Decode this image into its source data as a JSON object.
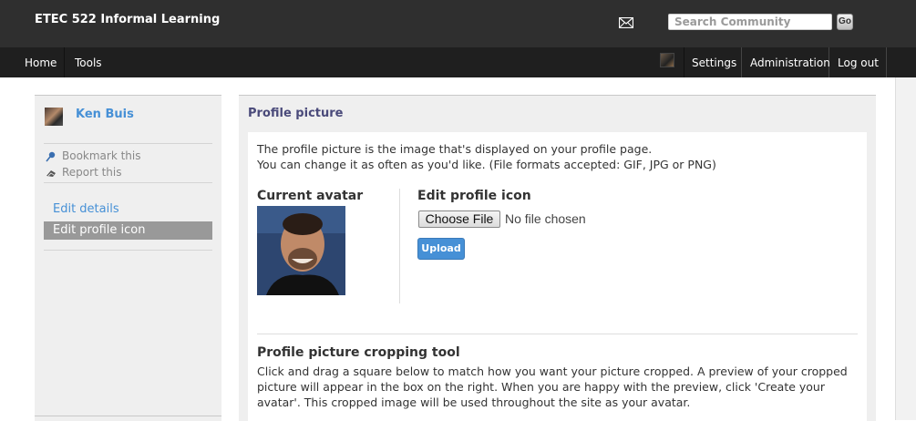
{
  "header": {
    "site_title": "ETEC 522 Informal Learning",
    "search_placeholder": "Search Community",
    "go_label": "Go"
  },
  "nav": {
    "left": [
      {
        "label": "Home"
      },
      {
        "label": "Tools"
      }
    ],
    "right": [
      {
        "label": "Settings"
      },
      {
        "label": "Administration"
      },
      {
        "label": "Log out"
      }
    ]
  },
  "sidebar": {
    "owner_name": "Ken Buis",
    "actions": [
      {
        "label": "Bookmark this"
      },
      {
        "label": "Report this"
      }
    ],
    "menu": [
      {
        "label": "Edit details",
        "selected": false
      },
      {
        "label": "Edit profile icon",
        "selected": true
      }
    ]
  },
  "main": {
    "title": "Profile picture",
    "description_line1": "The profile picture is the image that's displayed on your profile page.",
    "description_line2": "You can change it as often as you'd like. (File formats accepted: GIF, JPG or PNG)",
    "current_avatar_heading": "Current avatar",
    "edit_icon_heading": "Edit profile icon",
    "choose_file_label": "Choose File",
    "no_file_text": "No file chosen",
    "upload_label": "Upload",
    "crop_heading": "Profile picture cropping tool",
    "crop_description": "Click and drag a square below to match how you want your picture cropped. A preview of your cropped picture will appear in the box on the right. When you are happy with the preview, click 'Create your avatar'. This cropped image will be used throughout the site as your avatar."
  },
  "colors": {
    "topbar": "#2f2f2f",
    "navbar": "#1f1f1f",
    "link": "#4690d6",
    "selected_menu": "#999999",
    "upload_button": "#4690d6"
  },
  "icons": [
    "mail-icon",
    "pushpin-icon",
    "report-icon"
  ]
}
